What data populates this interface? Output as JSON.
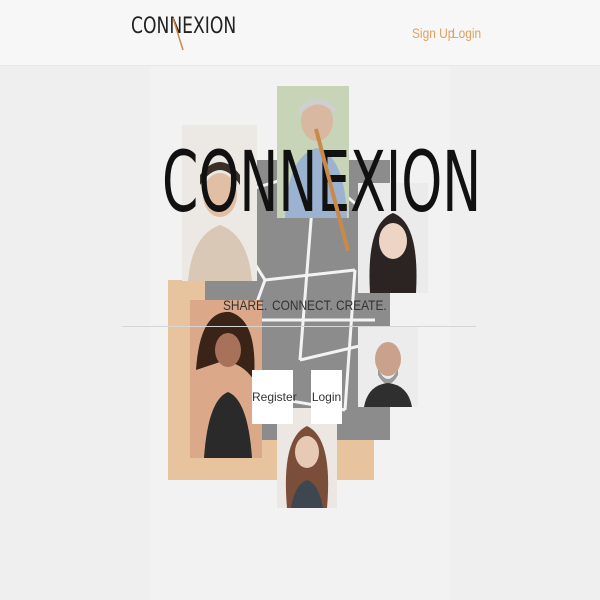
{
  "navbar": {
    "brand": "CONNEXION",
    "signup_label": "Sign Up",
    "login_label": "Login"
  },
  "hero": {
    "logo": "CONNEXION",
    "tagline": [
      "SHARE.",
      "CONNECT.",
      "CREATE."
    ],
    "register_label": "Register",
    "login_label": "Login"
  },
  "colors": {
    "accent": "#e0a060",
    "background": "#efefef",
    "orange_frame": "#e8c49e"
  }
}
